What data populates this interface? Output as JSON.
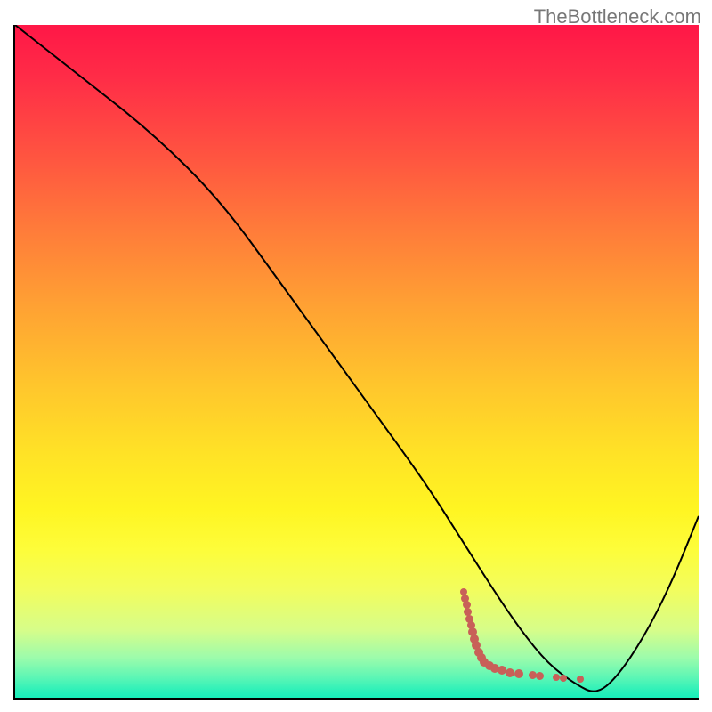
{
  "watermark": "TheBottleneck.com",
  "chart_data": {
    "type": "line",
    "title": "",
    "xlabel": "",
    "ylabel": "",
    "xlim": [
      0,
      100
    ],
    "ylim": [
      0,
      100
    ],
    "series": [
      {
        "name": "curve",
        "x": [
          0,
          10,
          20,
          30,
          40,
          50,
          60,
          65,
          70,
          74,
          78,
          82,
          85,
          88,
          92,
          96,
          100
        ],
        "y": [
          100,
          92,
          84,
          74,
          60,
          46,
          32,
          24,
          16,
          10,
          5,
          2,
          0.5,
          3,
          9,
          17,
          27
        ]
      }
    ],
    "markers": {
      "name": "red-dots",
      "color": "#c86058",
      "points": [
        {
          "x": 65.5,
          "y": 16.0,
          "r": 4.0
        },
        {
          "x": 65.7,
          "y": 15.0,
          "r": 4.5
        },
        {
          "x": 65.9,
          "y": 14.0,
          "r": 4.5
        },
        {
          "x": 66.1,
          "y": 13.0,
          "r": 4.5
        },
        {
          "x": 66.3,
          "y": 12.0,
          "r": 4.5
        },
        {
          "x": 66.5,
          "y": 11.0,
          "r": 4.5
        },
        {
          "x": 66.8,
          "y": 10.0,
          "r": 5.0
        },
        {
          "x": 67.0,
          "y": 9.0,
          "r": 5.0
        },
        {
          "x": 67.3,
          "y": 8.0,
          "r": 5.0
        },
        {
          "x": 67.6,
          "y": 7.0,
          "r": 5.0
        },
        {
          "x": 68.0,
          "y": 6.2,
          "r": 5.0
        },
        {
          "x": 68.5,
          "y": 5.5,
          "r": 5.0
        },
        {
          "x": 69.2,
          "y": 5.0,
          "r": 5.0
        },
        {
          "x": 70.0,
          "y": 4.6,
          "r": 5.0
        },
        {
          "x": 71.0,
          "y": 4.3,
          "r": 5.0
        },
        {
          "x": 72.2,
          "y": 4.0,
          "r": 5.0
        },
        {
          "x": 73.5,
          "y": 3.8,
          "r": 5.0
        },
        {
          "x": 75.5,
          "y": 3.6,
          "r": 4.5
        },
        {
          "x": 76.5,
          "y": 3.5,
          "r": 4.5
        },
        {
          "x": 79.0,
          "y": 3.3,
          "r": 4.0
        },
        {
          "x": 80.0,
          "y": 3.2,
          "r": 4.0
        },
        {
          "x": 82.5,
          "y": 3.1,
          "r": 4.0
        }
      ]
    }
  }
}
